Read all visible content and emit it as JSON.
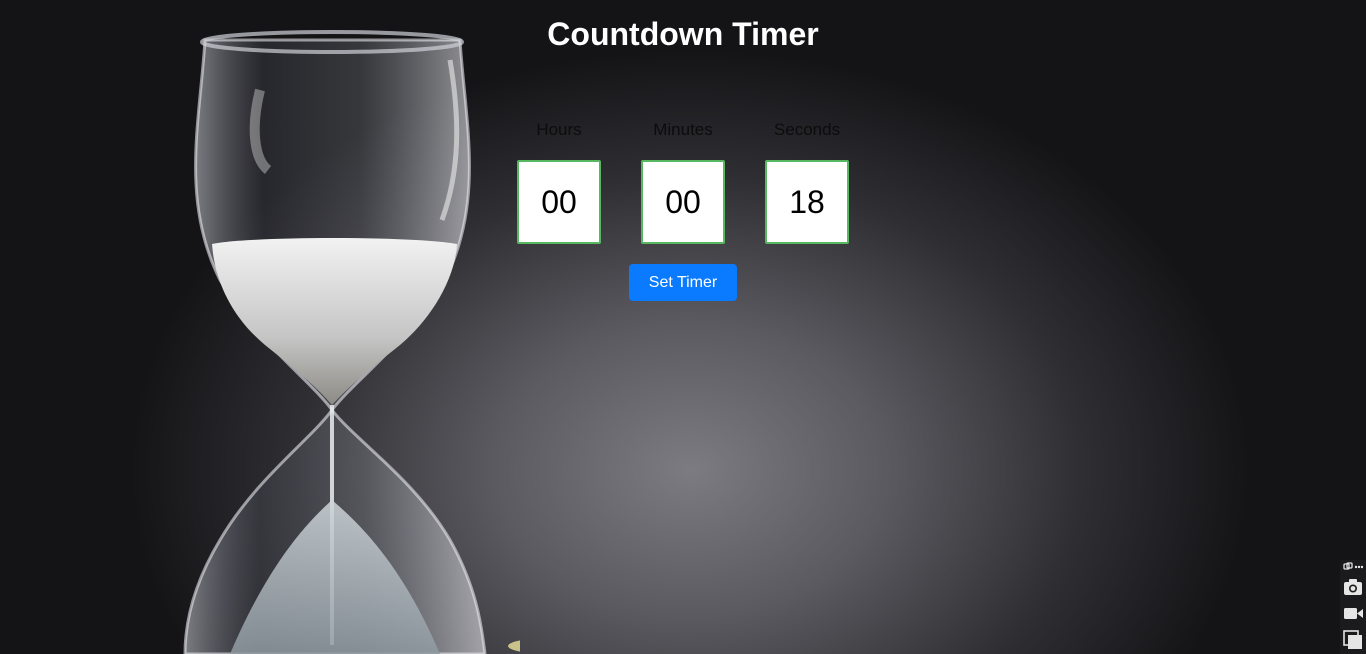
{
  "page": {
    "title": "Countdown Timer"
  },
  "timer": {
    "hours": {
      "label": "Hours",
      "value": "00"
    },
    "minutes": {
      "label": "Minutes",
      "value": "00"
    },
    "seconds": {
      "label": "Seconds",
      "value": "18"
    },
    "set_button_label": "Set Timer"
  },
  "colors": {
    "button": "#0a7bff",
    "input_border": "#58b860",
    "title": "#ffffff"
  },
  "tools": [
    {
      "icon": "link-icon"
    },
    {
      "icon": "more-icon"
    },
    {
      "icon": "camera-icon"
    },
    {
      "icon": "video-icon"
    },
    {
      "icon": "window-icon"
    }
  ]
}
